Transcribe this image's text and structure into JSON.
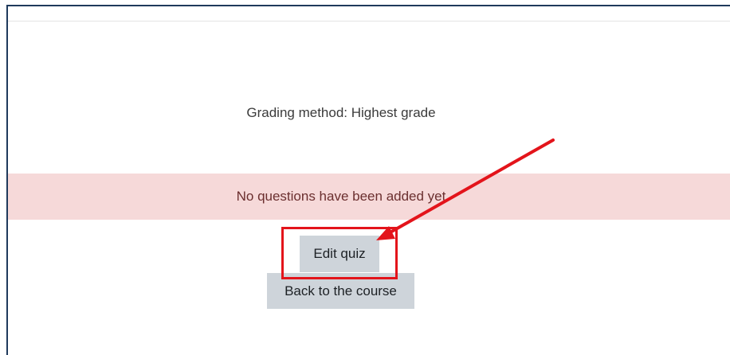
{
  "quiz": {
    "grading_method": "Grading method: Highest grade"
  },
  "alert": {
    "message": "No questions have been added yet"
  },
  "buttons": {
    "edit_quiz": "Edit quiz",
    "back_to_course": "Back to the course"
  },
  "colors": {
    "alert_background": "#f6d9d9",
    "button_background": "#ced4da",
    "annotation_red": "#e3141b"
  }
}
